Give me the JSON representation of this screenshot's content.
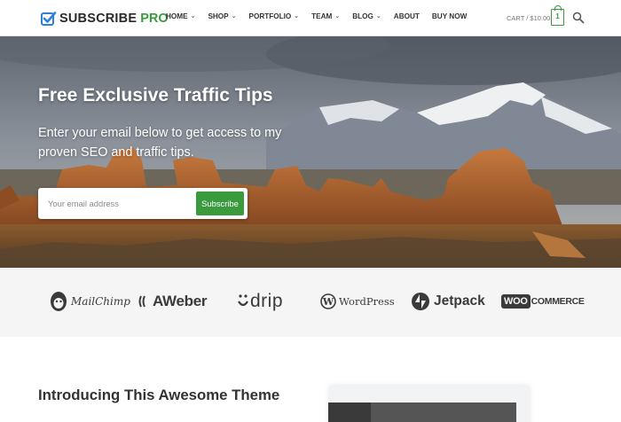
{
  "header": {
    "logo": {
      "name": "SUBSCRIBE",
      "accent": "PRO"
    },
    "nav": [
      {
        "label": "HOME",
        "dropdown": true
      },
      {
        "label": "SHOP",
        "dropdown": true
      },
      {
        "label": "PORTFOLIO",
        "dropdown": true
      },
      {
        "label": "TEAM",
        "dropdown": true
      },
      {
        "label": "BLOG",
        "dropdown": true
      },
      {
        "label": "ABOUT",
        "dropdown": false
      },
      {
        "label": "BUY NOW",
        "dropdown": false
      }
    ],
    "cart": {
      "label": "CART / $10.00",
      "count": "1"
    },
    "search_icon": "search-icon"
  },
  "hero": {
    "title": "Free Exclusive Traffic Tips",
    "subtitle": "Enter your email below to get access to my proven SEO and traffic tips.",
    "email_placeholder": "Your email address",
    "button_label": "Subscribe"
  },
  "brands": {
    "mailchimp": "MailChimp",
    "aweber": "AWeber",
    "drip": "drip",
    "wordpress": "WordPress",
    "jetpack": "Jetpack",
    "woo_a": "WOO",
    "woo_b": "COMMERCE"
  },
  "intro": {
    "title": "Introducing This Awesome Theme"
  },
  "colors": {
    "accent": "#3a9a3e",
    "logo_blue": "#2f7fd6",
    "strip_bg": "#f5f5f5"
  }
}
